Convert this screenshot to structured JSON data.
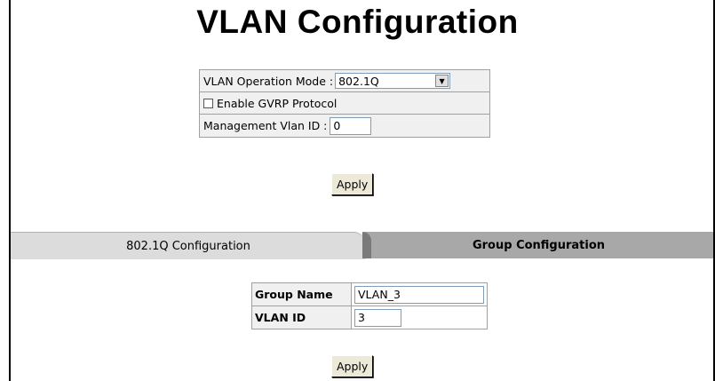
{
  "page": {
    "title": "VLAN Configuration"
  },
  "settings": {
    "mode_label": "VLAN Operation Mode :",
    "mode_value": "802.1Q",
    "gvrp_label": "Enable GVRP Protocol",
    "gvrp_checked": false,
    "mgmt_label": "Management Vlan ID :",
    "mgmt_value": "0",
    "apply_label": "Apply"
  },
  "tabs": [
    {
      "label": "802.1Q Configuration",
      "active": false
    },
    {
      "label": "Group Configuration",
      "active": true
    }
  ],
  "group": {
    "name_label": "Group Name",
    "name_value": "VLAN_3",
    "vid_label": "VLAN ID",
    "vid_value": "3",
    "apply_label": "Apply"
  }
}
